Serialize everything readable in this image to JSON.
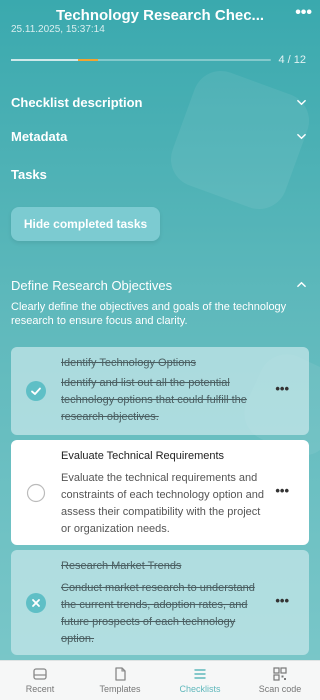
{
  "header": {
    "title": "Technology Research Chec...",
    "timestamp": "25.11.2025, 15:37:14"
  },
  "progress": {
    "completed": 4,
    "total": 12,
    "label": "4 / 12",
    "accent_color": "#f2a531"
  },
  "sections": {
    "description_label": "Checklist description",
    "metadata_label": "Metadata",
    "tasks_label": "Tasks"
  },
  "hide_button": {
    "label": "Hide completed tasks"
  },
  "group": {
    "title": "Define Research Objectives",
    "description": "Clearly define the objectives and goals of the technology research to ensure focus and clarity."
  },
  "tasks": [
    {
      "title": "Identify Technology Options",
      "description": "Identify and list out all the potential technology options that could fulfill the research objectives.",
      "status": "completed",
      "status_icon": "check-icon"
    },
    {
      "title": "Evaluate Technical Requirements",
      "description": "Evaluate the technical requirements and constraints of each technology option and assess their compatibility with the project or organization needs.",
      "status": "open",
      "status_icon": "empty-circle-icon"
    },
    {
      "title": "Research Market Trends",
      "description": "Conduct market research to understand the current trends, adoption rates, and future prospects of each technology option.",
      "status": "skipped",
      "status_icon": "cross-icon"
    }
  ],
  "more_glyph": "•••",
  "tabbar": {
    "items": [
      {
        "label": "Recent",
        "icon": "inbox-icon",
        "active": false
      },
      {
        "label": "Templates",
        "icon": "document-icon",
        "active": false
      },
      {
        "label": "Checklists",
        "icon": "list-icon",
        "active": true
      },
      {
        "label": "Scan code",
        "icon": "qr-code-icon",
        "active": false
      }
    ]
  },
  "colors": {
    "brand": "#4fb3b7",
    "check_fill": "#5fbfc6",
    "active_tab": "#5fb8bc"
  }
}
